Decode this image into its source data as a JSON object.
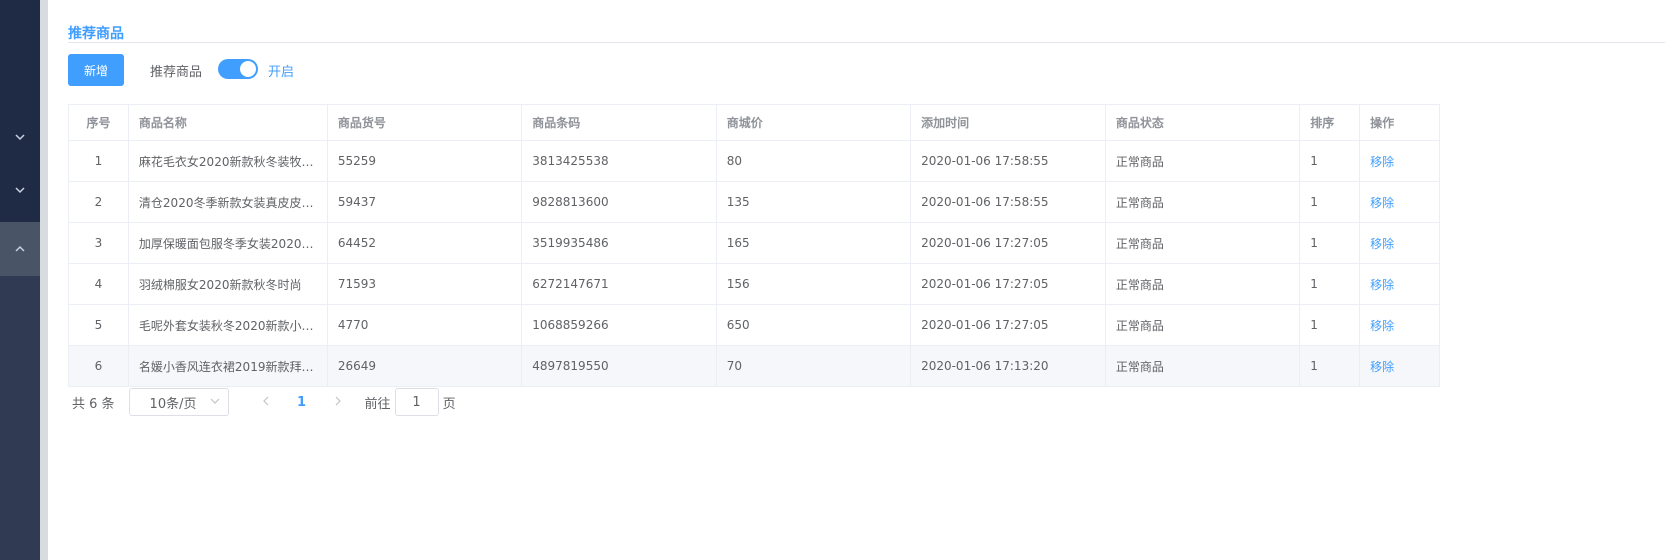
{
  "sidebar": {
    "items": [
      {
        "icon": "chevron-down-icon"
      },
      {
        "icon": "chevron-down-icon"
      },
      {
        "icon": "chevron-up-icon"
      }
    ]
  },
  "section": {
    "title": "推荐商品"
  },
  "toolbar": {
    "add_label": "新增",
    "switch_label": "推荐商品",
    "switch_state": "开启",
    "switch_on": true
  },
  "table": {
    "headers": [
      "序号",
      "商品名称",
      "商品货号",
      "商品条码",
      "商城价",
      "添加时间",
      "商品状态",
      "排序",
      "操作"
    ],
    "rows": [
      {
        "index": "1",
        "name": "麻花毛衣女2020新款秋冬装牧…",
        "sku": "55259",
        "barcode": "3813425538",
        "price": "80",
        "time": "2020-01-06 17:58:55",
        "status": "正常商品",
        "sort": "1",
        "action": "移除"
      },
      {
        "index": "2",
        "name": "清仓2020冬季新款女装真皮皮…",
        "sku": "59437",
        "barcode": "9828813600",
        "price": "135",
        "time": "2020-01-06 17:58:55",
        "status": "正常商品",
        "sort": "1",
        "action": "移除"
      },
      {
        "index": "3",
        "name": "加厚保暖面包服冬季女装2020…",
        "sku": "64452",
        "barcode": "3519935486",
        "price": "165",
        "time": "2020-01-06 17:27:05",
        "status": "正常商品",
        "sort": "1",
        "action": "移除"
      },
      {
        "index": "4",
        "name": "羽绒棉服女2020新款秋冬时尚",
        "sku": "71593",
        "barcode": "6272147671",
        "price": "156",
        "time": "2020-01-06 17:27:05",
        "status": "正常商品",
        "sort": "1",
        "action": "移除"
      },
      {
        "index": "5",
        "name": "毛呢外套女装秋冬2020新款小…",
        "sku": "4770",
        "barcode": "1068859266",
        "price": "650",
        "time": "2020-01-06 17:27:05",
        "status": "正常商品",
        "sort": "1",
        "action": "移除"
      },
      {
        "index": "6",
        "name": "名媛小香风连衣裙2019新款拜…",
        "sku": "26649",
        "barcode": "4897819550",
        "price": "70",
        "time": "2020-01-06 17:13:20",
        "status": "正常商品",
        "sort": "1",
        "action": "移除"
      }
    ]
  },
  "pagination": {
    "total_label": "共 6 条",
    "page_size": "10条/页",
    "current_page": "1",
    "jump_prefix": "前往",
    "jump_value": "1",
    "jump_suffix": "页"
  }
}
